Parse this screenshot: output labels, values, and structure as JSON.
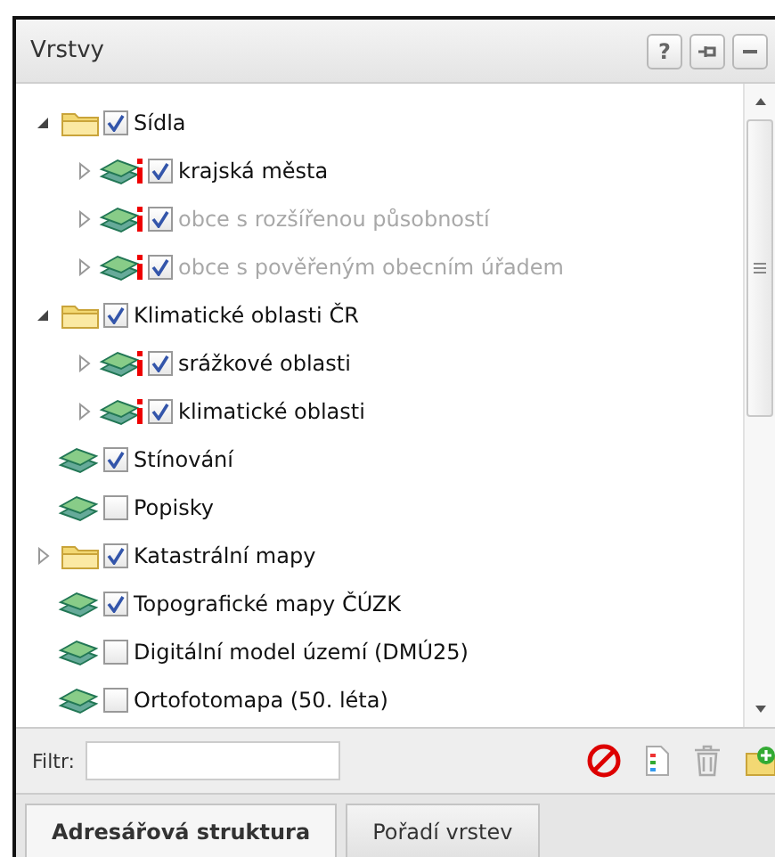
{
  "panel": {
    "title": "Vrstvy",
    "buttons": [
      {
        "kind": "help",
        "label": "?"
      },
      {
        "kind": "pin"
      },
      {
        "kind": "minimize"
      }
    ]
  },
  "tree": [
    {
      "kind": "folder",
      "label": "Sídla",
      "checked": true,
      "expanded": true,
      "disabled": false,
      "children": [
        {
          "kind": "info-layer",
          "label": "krajská města",
          "checked": true,
          "expanded": false,
          "disabled": false
        },
        {
          "kind": "info-layer",
          "label": "obce s rozšířenou působností",
          "checked": true,
          "expanded": false,
          "disabled": true
        },
        {
          "kind": "info-layer",
          "label": "obce s pověřeným obecním úřadem",
          "checked": true,
          "expanded": false,
          "disabled": true
        }
      ]
    },
    {
      "kind": "folder",
      "label": "Klimatické oblasti ČR",
      "checked": true,
      "expanded": true,
      "disabled": false,
      "children": [
        {
          "kind": "info-layer",
          "label": "srážkové oblasti",
          "checked": true,
          "expanded": false,
          "disabled": false
        },
        {
          "kind": "info-layer",
          "label": "klimatické oblasti",
          "checked": true,
          "expanded": false,
          "disabled": false
        }
      ]
    },
    {
      "kind": "layer",
      "label": "Stínování",
      "checked": true,
      "disabled": false
    },
    {
      "kind": "layer",
      "label": "Popisky",
      "checked": false,
      "disabled": false
    },
    {
      "kind": "folder",
      "label": "Katastrální mapy",
      "checked": true,
      "expanded": false,
      "disabled": false
    },
    {
      "kind": "layer",
      "label": "Topografické mapy ČÚZK",
      "checked": true,
      "disabled": false
    },
    {
      "kind": "layer",
      "label": "Digitální model území (DMÚ25)",
      "checked": false,
      "disabled": false
    },
    {
      "kind": "layer",
      "label": "Ortofotomapa (50. léta)",
      "checked": false,
      "disabled": false
    }
  ],
  "filter": {
    "label": "Filtr:"
  },
  "tools": [
    {
      "kind": "clear"
    },
    {
      "kind": "legend"
    },
    {
      "kind": "delete"
    },
    {
      "kind": "add-folder"
    }
  ],
  "tabs": [
    {
      "label": "Adresářová struktura",
      "selected": true
    },
    {
      "label": "Pořadí vrstev",
      "selected": false
    }
  ]
}
